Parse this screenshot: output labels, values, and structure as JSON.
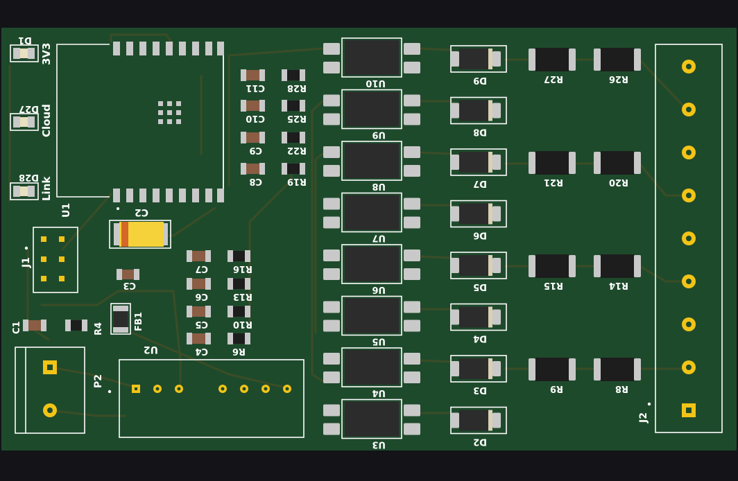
{
  "board": {
    "colors": {
      "background": "#131318",
      "soldermask": "#1e4a2c",
      "silkscreen": "#ffffff",
      "pad": "#c9c9c9",
      "ic_body": "#2c2c2c",
      "cap_body": "#8a5d44",
      "res_body": "#1d1d1d",
      "gold": "#f2c417",
      "tantalum": "#f6d23a"
    }
  },
  "labels": {
    "u1": "U1",
    "u2": "U2",
    "j1": "J1",
    "j2": "J2",
    "p2": "P2",
    "d1": "D1",
    "led_3v3": "3V3",
    "d27": "D27",
    "led_cloud": "Cloud",
    "d28": "D28",
    "led_link": "Link",
    "c1": "C1",
    "r4": "R4",
    "c2": "C2",
    "c3": "C3",
    "fb1": "FB1",
    "c11": "C11",
    "c10": "C10",
    "c9": "C9",
    "c8": "C8",
    "r28": "R28",
    "r25": "R25",
    "r22": "R22",
    "r19": "R19",
    "c7": "C7",
    "c6": "C6",
    "c5": "C5",
    "c4": "C4",
    "r16": "R16",
    "r13": "R13",
    "r10": "R10",
    "r6": "R6"
  },
  "optos": [
    "U10",
    "U9",
    "U8",
    "U7",
    "U6",
    "U5",
    "U4",
    "U3"
  ],
  "diodes": [
    "D9",
    "D8",
    "D7",
    "D6",
    "D5",
    "D4",
    "D3",
    "D2"
  ],
  "resistor_pairs": [
    {
      "a": "R27",
      "b": "R26"
    },
    {
      "a": "R21",
      "b": "R20"
    },
    {
      "a": "R15",
      "b": "R14"
    },
    {
      "a": "R9",
      "b": "R8"
    }
  ]
}
